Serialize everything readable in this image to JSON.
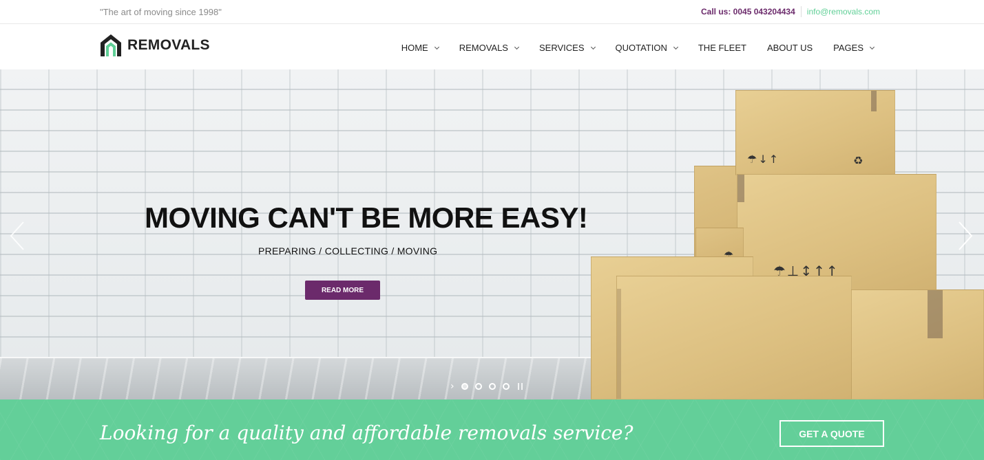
{
  "topbar": {
    "tagline": "\"The art of moving since 1998\"",
    "phone": "Call us: 0045 043204434",
    "email": "info@removals.com"
  },
  "header": {
    "logo_text": "REMOVALS",
    "nav": [
      {
        "label": "HOME",
        "has_dropdown": true
      },
      {
        "label": "REMOVALS",
        "has_dropdown": true
      },
      {
        "label": "SERVICES",
        "has_dropdown": true
      },
      {
        "label": "QUOTATION",
        "has_dropdown": true
      },
      {
        "label": "THE FLEET",
        "has_dropdown": false
      },
      {
        "label": "ABOUT US",
        "has_dropdown": false
      },
      {
        "label": "PAGES",
        "has_dropdown": true
      }
    ]
  },
  "hero": {
    "title": "MOVING CAN'T BE MORE EASY!",
    "subtitle": "PREPARING / COLLECTING / MOVING",
    "button_label": "READ MORE",
    "slide_count": 4,
    "active_slide": 1
  },
  "cta": {
    "text": "Looking for a quality and affordable removals service?",
    "button_label": "GET A QUOTE"
  },
  "colors": {
    "brand_purple": "#6b2a6b",
    "brand_green": "#5fcf96",
    "cta_background": "#63cf99"
  }
}
